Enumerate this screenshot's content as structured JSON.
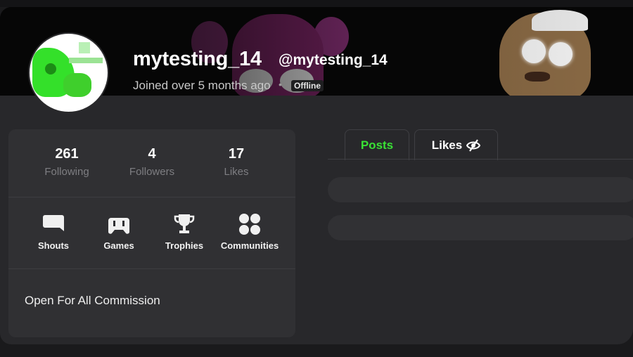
{
  "profile": {
    "display_name": "mytesting_14",
    "handle": "@mytesting_14",
    "joined": "Joined over 5 months ago",
    "separator": "•",
    "status": "Offline"
  },
  "stats": [
    {
      "value": "261",
      "label": "Following"
    },
    {
      "value": "4",
      "label": "Followers"
    },
    {
      "value": "17",
      "label": "Likes"
    }
  ],
  "nav": [
    {
      "label": "Shouts",
      "icon": "speech-bubble-icon"
    },
    {
      "label": "Games",
      "icon": "gamepad-icon"
    },
    {
      "label": "Trophies",
      "icon": "trophy-icon"
    },
    {
      "label": "Communities",
      "icon": "four-dots-icon"
    }
  ],
  "bio": "Open For All Commission",
  "tabs": [
    {
      "label": "Posts",
      "active": true
    },
    {
      "label": "Likes",
      "icon": "eye-slash-icon"
    }
  ],
  "colors": {
    "accent": "#39e135",
    "background": "#28282b",
    "card": "#303033"
  }
}
